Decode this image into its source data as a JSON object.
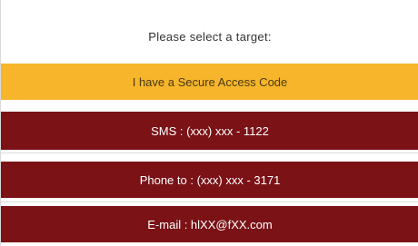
{
  "prompt": "Please select a target:",
  "options": [
    {
      "label": "I have a Secure Access Code",
      "color": "#f7b52b"
    },
    {
      "label": "SMS : (xxx) xxx - 1122",
      "color": "#7a1216"
    },
    {
      "label": "Phone to : (xxx) xxx - 3171",
      "color": "#7a1216"
    },
    {
      "label": "E-mail : hlXX@fXX.com",
      "color": "#7a1216"
    }
  ]
}
